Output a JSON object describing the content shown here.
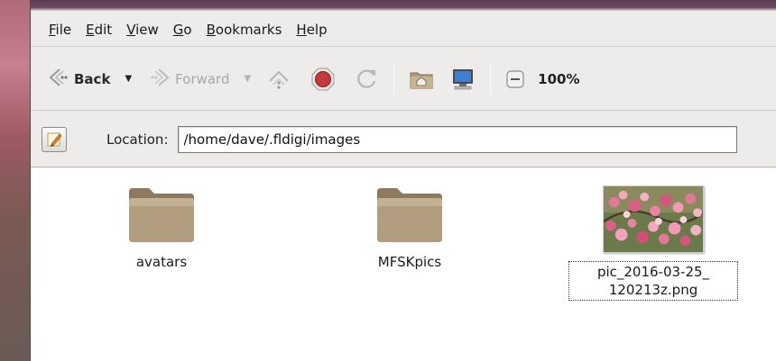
{
  "menubar": {
    "items": [
      "File",
      "Edit",
      "View",
      "Go",
      "Bookmarks",
      "Help"
    ]
  },
  "toolbar": {
    "back_label": "Back",
    "forward_label": "Forward",
    "zoom_level": "100%"
  },
  "location": {
    "label": "Location:",
    "value": "/home/dave/.fldigi/images"
  },
  "files": [
    {
      "name": "avatars",
      "type": "folder"
    },
    {
      "name": "MFSKpics",
      "type": "folder"
    },
    {
      "name_line1": "pic_2016-03-25_",
      "name_line2": "120213z.png",
      "type": "image"
    }
  ],
  "colors": {
    "window_bg": "#edeceb",
    "folder": "#a8967a",
    "stop": "#c23a3a"
  }
}
